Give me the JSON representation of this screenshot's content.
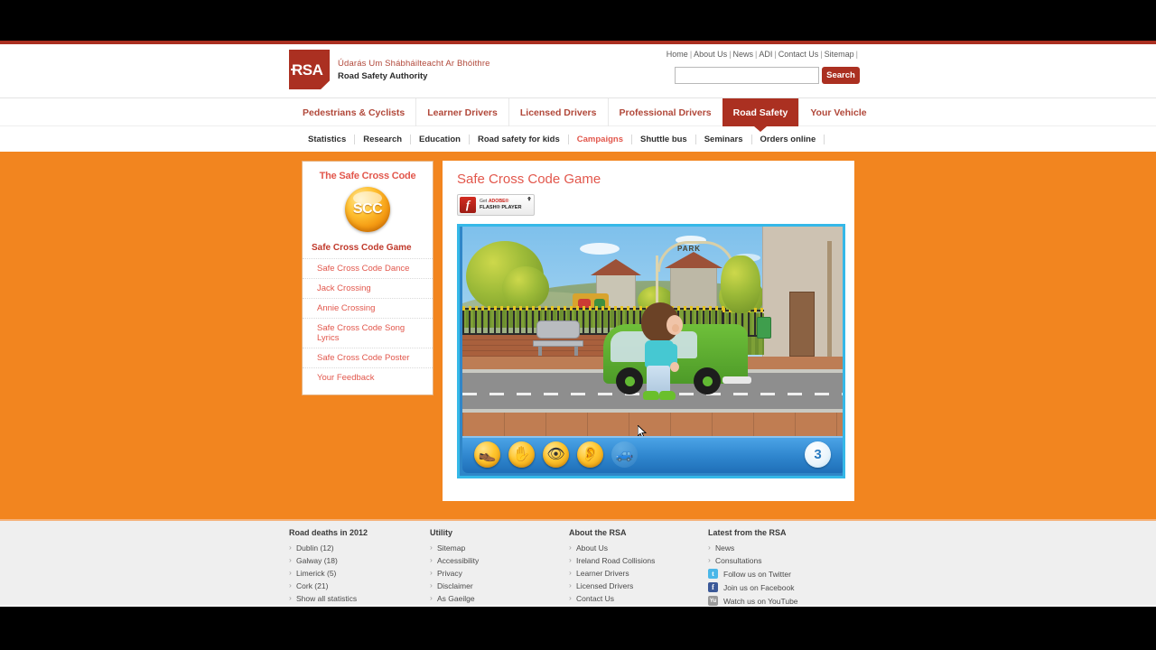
{
  "brand": {
    "logo_abbr": "RSA",
    "name_ga": "Údarás Um Shábháilteacht Ar Bhóithre",
    "name_en": "Road Safety Authority",
    "accent_red": "#ab3021",
    "accent_orange": "#f2851f",
    "link_red": "#e2574c"
  },
  "utility_nav": {
    "items": [
      "Home",
      "About Us",
      "News",
      "ADI",
      "Contact Us",
      "Sitemap"
    ],
    "separator": "|"
  },
  "search": {
    "value": "",
    "placeholder": "",
    "button_label": "Search"
  },
  "main_nav": {
    "items": [
      {
        "label": "Pedestrians & Cyclists",
        "active": false
      },
      {
        "label": "Learner Drivers",
        "active": false
      },
      {
        "label": "Licensed Drivers",
        "active": false
      },
      {
        "label": "Professional Drivers",
        "active": false
      },
      {
        "label": "Road Safety",
        "active": true
      },
      {
        "label": "Your Vehicle",
        "active": false
      }
    ]
  },
  "sub_nav": {
    "items": [
      {
        "label": "Statistics",
        "current": false
      },
      {
        "label": "Research",
        "current": false
      },
      {
        "label": "Education",
        "current": false
      },
      {
        "label": "Road safety for kids",
        "current": false
      },
      {
        "label": "Campaigns",
        "current": true
      },
      {
        "label": "Shuttle bus",
        "current": false
      },
      {
        "label": "Seminars",
        "current": false
      },
      {
        "label": "Orders online",
        "current": false
      }
    ]
  },
  "sidebar": {
    "title": "The Safe Cross Code",
    "badge_text": "SCC",
    "heading": "Safe Cross Code Game",
    "links": [
      "Safe Cross Code Dance",
      "Jack Crossing",
      "Annie Crossing",
      "Safe Cross Code Song Lyrics",
      "Safe Cross Code Poster",
      "Your Feedback"
    ]
  },
  "content": {
    "title": "Safe Cross Code Game",
    "flash_badge": {
      "glyph": "f",
      "line1_prefix": "Get ",
      "line1_brand": "ADOBE®",
      "line2": "FLASH® PLAYER"
    }
  },
  "game": {
    "scene": {
      "park_sign": "PARK",
      "character": "boy",
      "vehicle": "green-van"
    },
    "toolbar": {
      "senses": [
        {
          "name": "foot-icon",
          "glyph": "👞",
          "enabled": true
        },
        {
          "name": "hand-icon",
          "glyph": "✋",
          "enabled": true
        },
        {
          "name": "eye-icon",
          "glyph": "👁",
          "enabled": true
        },
        {
          "name": "ear-icon",
          "glyph": "👂",
          "enabled": true
        },
        {
          "name": "vehicle-icon",
          "glyph": "🚙",
          "enabled": false
        }
      ],
      "counter": "3"
    }
  },
  "footer": {
    "columns": [
      {
        "heading": "Road deaths in 2012",
        "links": [
          "Dublin (12)",
          "Galway (18)",
          "Limerick (5)",
          "Cork (21)",
          "Show all statistics"
        ]
      },
      {
        "heading": "Utility",
        "links": [
          "Sitemap",
          "Accessibility",
          "Privacy",
          "Disclaimer",
          "As Gaeilge"
        ]
      },
      {
        "heading": "About the RSA",
        "links": [
          "About Us",
          "Ireland Road Collisions",
          "Learner Drivers",
          "Licensed Drivers",
          "Contact Us"
        ]
      },
      {
        "heading": "Latest from the RSA",
        "links": [
          "News",
          "Consultations"
        ],
        "social": [
          {
            "label": "Follow us on Twitter",
            "glyph": "t",
            "cls": "soc-tw"
          },
          {
            "label": "Join us on Facebook",
            "glyph": "f",
            "cls": "soc-fb"
          },
          {
            "label": "Watch us on YouTube",
            "glyph": "Yu",
            "cls": "soc-yt"
          }
        ]
      }
    ]
  }
}
